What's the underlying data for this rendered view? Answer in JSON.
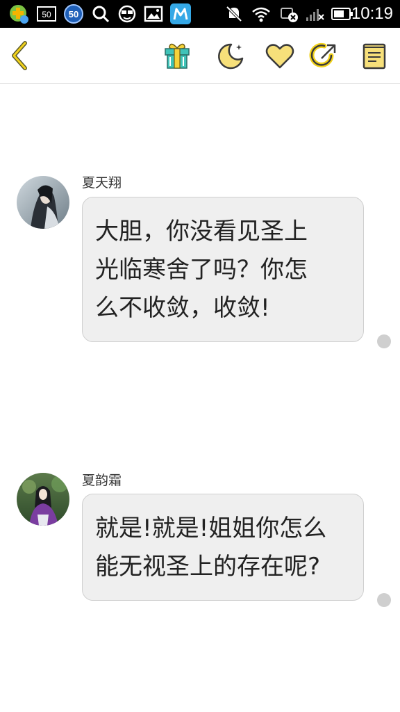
{
  "status_bar": {
    "time": "10:19",
    "badge_a": "50",
    "badge_b": "50",
    "icons": [
      "app-notification-icon",
      "sim-50-icon",
      "circle-50-icon",
      "search-icon",
      "face-icon",
      "image-icon",
      "m-app-icon",
      "mute-icon",
      "wifi-icon",
      "data-off-icon",
      "signal-icon",
      "battery-icon"
    ]
  },
  "toolbar": {
    "icons": [
      "back-icon",
      "gift-icon",
      "night-mode-icon",
      "heart-icon",
      "share-icon",
      "notes-icon"
    ],
    "accent": "#f2d21b"
  },
  "messages": [
    {
      "sender": "夏天翔",
      "lines": [
        "大胆，你没看见圣上",
        "光临寒舍了吗？你怎",
        "么不收敛，收敛!"
      ]
    },
    {
      "sender": "夏韵霜",
      "lines": [
        "就是!就是!姐姐你怎么",
        "能无视圣上的存在呢?"
      ]
    }
  ]
}
